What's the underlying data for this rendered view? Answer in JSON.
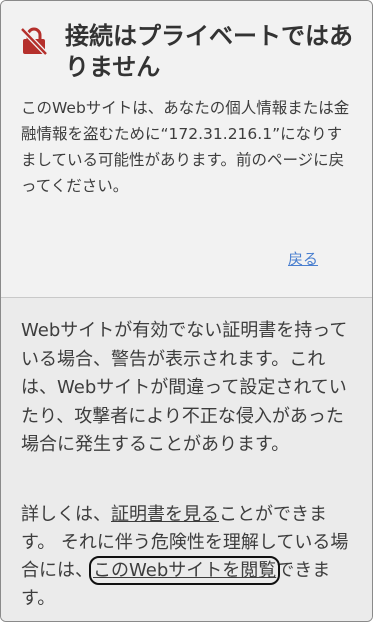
{
  "header": {
    "title": "接続はプライベートではありません",
    "icon": "lock-slash-icon",
    "icon_color": "#b5302c"
  },
  "warning": {
    "message": "このWebサイトは、あなたの個人情報または金融情報を盗むために“172.31.216.1”になりすましている可能性があります。前のページに戻ってください。",
    "back_label": "戻る"
  },
  "details": {
    "explanation": "Webサイトが有効でない証明書を持っている場合、警告が表示されます。これは、Webサイトが間違って設定されていたり、攻撃者により不正な侵入があった場合に発生することがあります。",
    "more_prefix": "詳しくは、",
    "view_cert_label": "証明書を見る",
    "more_middle": "ことができます。 それに伴う危険性を理解している場合には、",
    "visit_label": "このWebサイトを閲覧",
    "more_suffix": "できます。"
  },
  "colors": {
    "link": "#4a7fcf",
    "top_bg": "#f2f2f2",
    "bottom_bg": "#ebebeb"
  }
}
